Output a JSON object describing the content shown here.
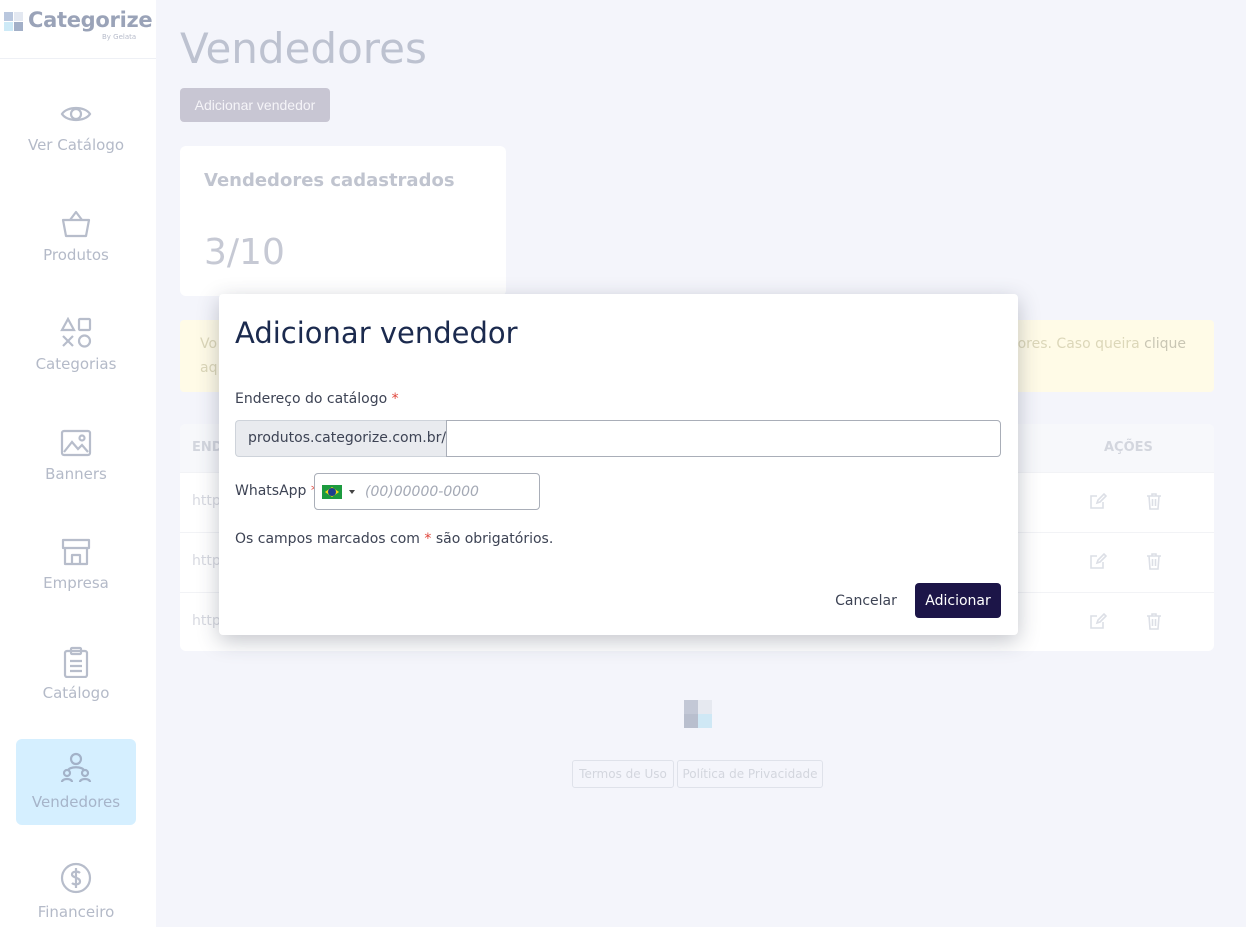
{
  "app": {
    "logo_text": "Categorize",
    "logo_sub": "By Gelata"
  },
  "sidebar": {
    "items": [
      {
        "label": "Ver Catálogo",
        "icon": "eye-icon"
      },
      {
        "label": "Produtos",
        "icon": "basket-icon"
      },
      {
        "label": "Categorias",
        "icon": "shapes-icon"
      },
      {
        "label": "Banners",
        "icon": "image-icon"
      },
      {
        "label": "Empresa",
        "icon": "store-icon"
      },
      {
        "label": "Catálogo",
        "icon": "clipboard-icon"
      },
      {
        "label": "Vendedores",
        "icon": "users-icon",
        "active": true
      },
      {
        "label": "Financeiro",
        "icon": "dollar-icon"
      }
    ]
  },
  "main": {
    "title": "Vendedores",
    "add_button": "Adicionar vendedor",
    "stat_card": {
      "title": "Vendedores cadastrados",
      "value": "3/10"
    },
    "warning": {
      "line1_start": "Vo",
      "line2_start": "aq",
      "right_text": "dores. Caso queira ",
      "right_link": "clique"
    },
    "table": {
      "header_left": "END",
      "header_actions": "AÇÕES",
      "rows": [
        {
          "cell": "http"
        },
        {
          "cell": "http"
        },
        {
          "cell": "http"
        }
      ]
    },
    "footer": {
      "terms": "Termos de Uso",
      "privacy": "Política de Privacidade"
    }
  },
  "modal": {
    "title": "Adicionar vendedor",
    "catalog_label": "Endereço do catálogo",
    "catalog_prefix": "produtos.categorize.com.br/",
    "catalog_value": "",
    "whatsapp_label": "WhatsApp",
    "whatsapp_placeholder": "(00)00000-0000",
    "whatsapp_country": "BR",
    "required_mark": "*",
    "note_before": "Os campos marcados com ",
    "note_after": " são obrigatórios.",
    "cancel_label": "Cancelar",
    "submit_label": "Adicionar"
  },
  "colors": {
    "primary": "#1c1548",
    "required": "#e0443a",
    "active_nav": "#d5efff"
  }
}
